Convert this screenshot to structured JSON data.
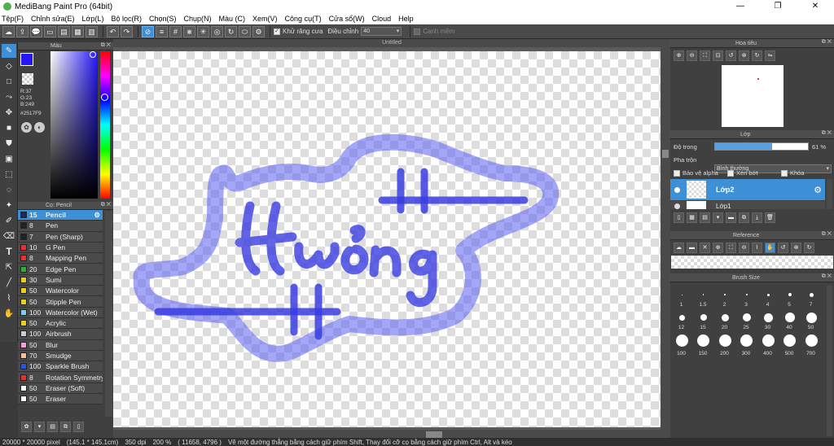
{
  "window": {
    "title": "MediBang Paint Pro (64bit)"
  },
  "menu": [
    "Tệp(F)",
    "Chỉnh sửa(E)",
    "Lớp(L)",
    "Bộ lọc(R)",
    "Chọn(S)",
    "Chụp(N)",
    "Màu (C)",
    "Xem(V)",
    "Công cụ(T)",
    "Cửa sổ(W)",
    "Cloud",
    "Help"
  ],
  "toolbar": {
    "antialias": "Khử răng cưa",
    "adjust_label": "Điều chỉnh",
    "adjust_value": "40",
    "smooth": "Canh mềm"
  },
  "color_panel": {
    "title": "Màu",
    "r": "R:37",
    "g": "G:23",
    "b": "B:249",
    "hex": "#2517F9",
    "fg": "#2517F9"
  },
  "brush_panel": {
    "title": "Cọ: Pencil",
    "brushes": [
      {
        "size": "15",
        "name": "Pencil",
        "color": "#1e2a5a"
      },
      {
        "size": "8",
        "name": "Pen",
        "color": "#222222"
      },
      {
        "size": "7",
        "name": "Pen (Sharp)",
        "color": "#222222"
      },
      {
        "size": "10",
        "name": "G Pen",
        "color": "#e83030"
      },
      {
        "size": "8",
        "name": "Mapping Pen",
        "color": "#e83030"
      },
      {
        "size": "20",
        "name": "Edge Pen",
        "color": "#30b030"
      },
      {
        "size": "30",
        "name": "Sumi",
        "color": "#e8d020"
      },
      {
        "size": "50",
        "name": "Watercolor",
        "color": "#e8d020"
      },
      {
        "size": "50",
        "name": "Stipple Pen",
        "color": "#e8d020"
      },
      {
        "size": "100",
        "name": "Watercolor (Wet)",
        "color": "#80d0f0"
      },
      {
        "size": "50",
        "name": "Acrylic",
        "color": "#e8d020"
      },
      {
        "size": "100",
        "name": "Airbrush",
        "color": "#cccccc"
      },
      {
        "size": "50",
        "name": "Blur",
        "color": "#f0a0e0"
      },
      {
        "size": "70",
        "name": "Smudge",
        "color": "#f0c0a0"
      },
      {
        "size": "100",
        "name": "Sparkle Brush",
        "color": "#3050e0"
      },
      {
        "size": "8",
        "name": "Rotation Symmetry",
        "color": "#e83030"
      },
      {
        "size": "50",
        "name": "Eraser (Soft)",
        "color": "#ffffff"
      },
      {
        "size": "50",
        "name": "Eraser",
        "color": "#ffffff"
      }
    ]
  },
  "canvas": {
    "tab": "Untitled",
    "stroke": "#2517F9"
  },
  "navigator": {
    "title": "Hoa tiêu"
  },
  "layer_panel": {
    "title": "Lớp",
    "opacity_label": "Độ trong",
    "opacity_value": "61 %",
    "opacity": 0.61,
    "blend_label": "Pha trộn",
    "blend_value": "Bình thường",
    "protect_alpha": "Bảo vệ alpha",
    "clip": "Xén bớt",
    "lock": "Khóa",
    "layers": [
      "Lớp2",
      "Lớp1"
    ]
  },
  "reference": {
    "title": "Reference"
  },
  "brush_size": {
    "title": "Brush Size",
    "sizes": [
      "1",
      "1.5",
      "2",
      "3",
      "4",
      "5",
      "7",
      "12",
      "15",
      "20",
      "25",
      "30",
      "40",
      "50",
      "100",
      "150",
      "200",
      "300",
      "400",
      "500",
      "700"
    ]
  },
  "status": {
    "size": "20000 * 20000 pixel",
    "cm": "(145.1 * 145.1cm)",
    "dpi": "350 dpi",
    "zoom": "200 %",
    "coords": "( 11658, 4796 )",
    "hint": "Vẽ một đường thẳng bằng cách giữ phím Shift, Thay đổi cỡ cọ bằng cách giữ phím Ctrl, Alt và kéo"
  }
}
